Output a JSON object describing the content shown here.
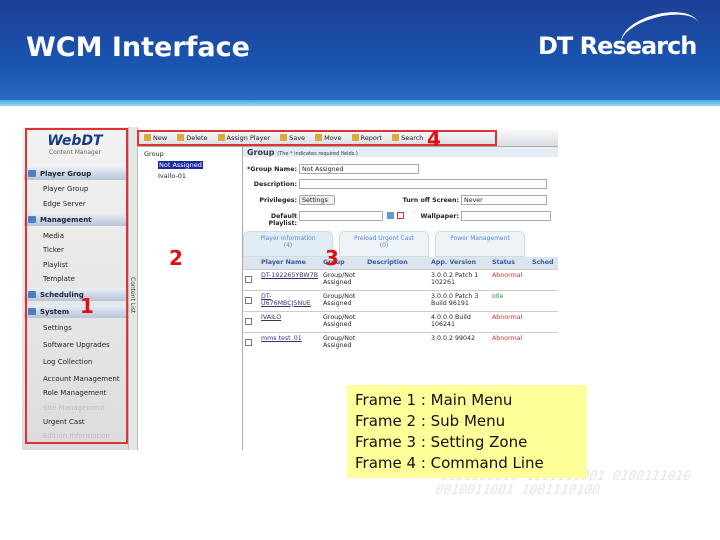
{
  "slide": {
    "title": "WCM Interface",
    "brand": "DT Research"
  },
  "sidebar": {
    "logo": "WebDT",
    "logo_sub": "Content Manager",
    "categories": [
      "Player Group",
      "Management",
      "Scheduling",
      "System"
    ],
    "player_group_items": [
      "Player Group",
      "Edge Server"
    ],
    "management_items": [
      "Media",
      "Ticker",
      "Playlist",
      "Template"
    ],
    "system_items": [
      "Settings",
      "Software Upgrades",
      "Log Collection",
      "Account Management",
      "Role Management",
      "Site Management",
      "Urgent Cast",
      "Edition Information"
    ]
  },
  "strip_label": "Content List",
  "toolbar": [
    "New",
    "Delete",
    "Assign Player",
    "Save",
    "Move",
    "Report",
    "Search"
  ],
  "tree": {
    "root": "Group",
    "children": [
      "Not Assigned",
      "Ivailo-01"
    ]
  },
  "form": {
    "heading": "Group",
    "note": "(The * indicates required fields.)",
    "group_name_label": "*Group Name:",
    "group_name": "Not Assigned",
    "description_label": "Description:",
    "privileges_label": "Privileges:",
    "settings_button": "Settings",
    "turn_off_label": "Turn off Screen:",
    "turn_off_value": "Never",
    "default_playlist_label": "Default Playlist:",
    "wallpaper_label": "Wallpaper:"
  },
  "tabs": [
    {
      "label": "Player Information",
      "count": "(4)"
    },
    {
      "label": "Preload Urgent Cast",
      "count": "(0)"
    },
    {
      "label": "Power Management",
      "count": ""
    }
  ],
  "table": {
    "headers": [
      "Player Name",
      "Group",
      "Description",
      "App. Version",
      "Status",
      "Sched"
    ],
    "rows": [
      {
        "name": "DT-192265YBW7B",
        "group": "Group/Not Assigned",
        "desc": "",
        "version": "3.0.0.2 Patch 1 102261",
        "status": "Abnormal"
      },
      {
        "name": "DT-U676MBCJ5NUE",
        "group": "Group/Not Assigned",
        "desc": "",
        "version": "3.0.0.0 Patch 3 Build 96191",
        "status": "Idle"
      },
      {
        "name": "IVAILO",
        "group": "Group/Not Assigned",
        "desc": "",
        "version": "4.0.0.0 Build 106241",
        "status": "Abnormal"
      },
      {
        "name": "mms test_01",
        "group": "Group/Not Assigned",
        "desc": "",
        "version": "3.0.0.2 99042",
        "status": "Abnormal"
      }
    ]
  },
  "frame_numbers": [
    "1",
    "2",
    "3",
    "4"
  ],
  "legend": [
    "Frame 1 : Main Menu",
    "Frame 2 : Sub Menu",
    "Frame 3 : Setting Zone",
    "Frame 4 : Command Line"
  ],
  "binary": "0101100010 1011110001 0100111010 0010011001 1001110100"
}
